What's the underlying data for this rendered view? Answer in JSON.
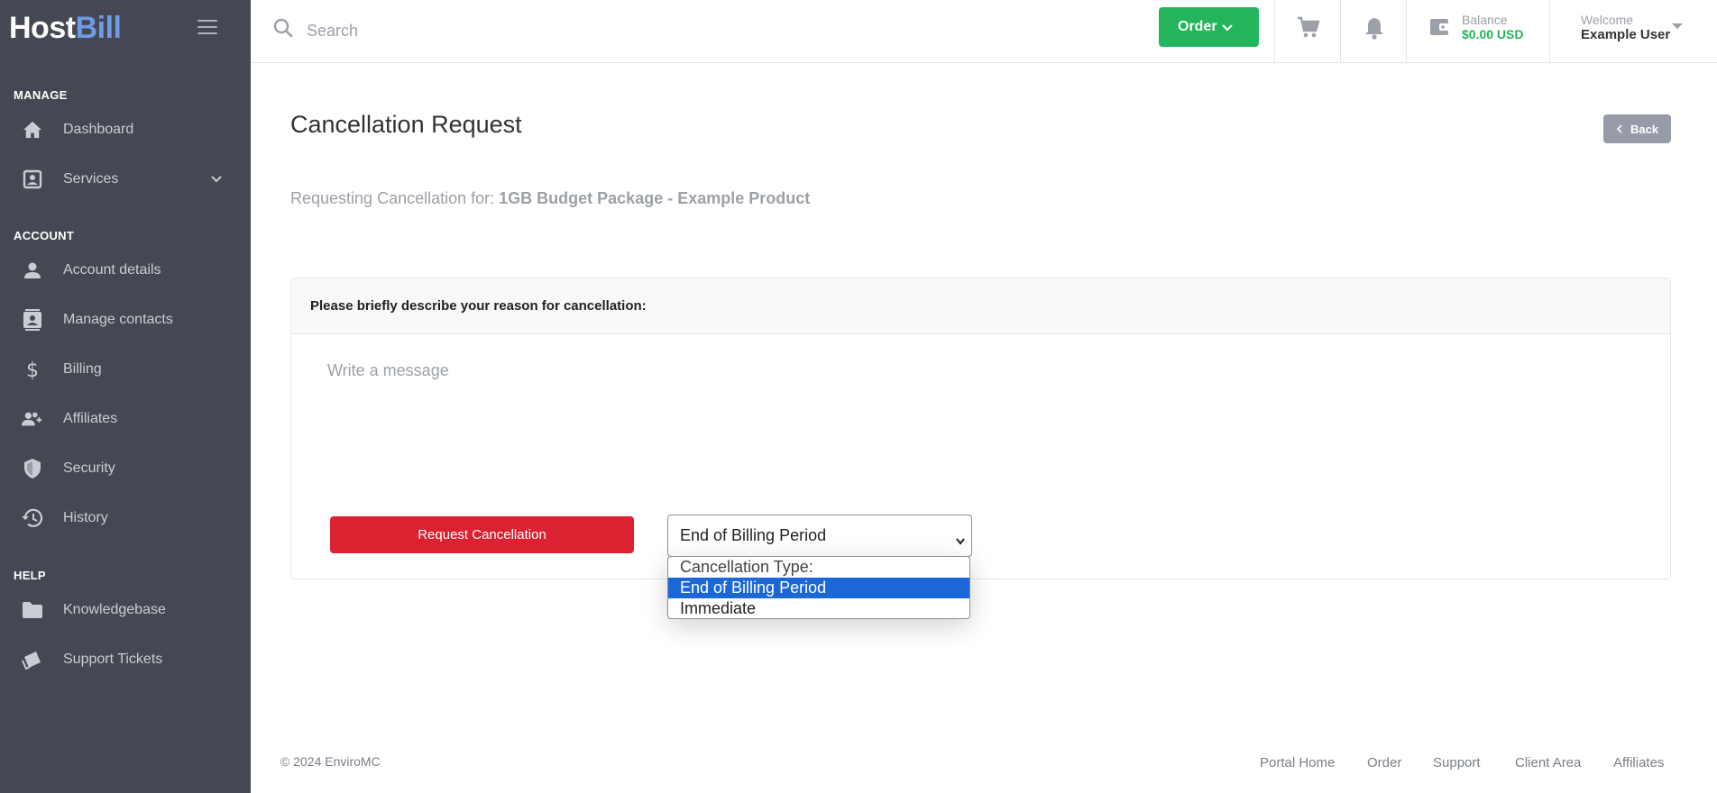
{
  "brand": {
    "host": "Host",
    "bill": "Bill"
  },
  "sidebar": {
    "sections": {
      "manage": "MANAGE",
      "account": "ACCOUNT",
      "help": "HELP"
    },
    "items": [
      {
        "label": "Dashboard",
        "icon": "home-icon"
      },
      {
        "label": "Services",
        "icon": "services-icon"
      },
      {
        "label": "Account details",
        "icon": "user-icon"
      },
      {
        "label": "Manage contacts",
        "icon": "contacts-icon"
      },
      {
        "label": "Billing",
        "icon": "dollar-icon"
      },
      {
        "label": "Affiliates",
        "icon": "affiliates-icon"
      },
      {
        "label": "Security",
        "icon": "shield-icon"
      },
      {
        "label": "History",
        "icon": "history-icon"
      },
      {
        "label": "Knowledgebase",
        "icon": "folder-icon"
      },
      {
        "label": "Support Tickets",
        "icon": "tickets-icon"
      }
    ]
  },
  "topbar": {
    "search_placeholder": "Search",
    "order_label": "Order",
    "balance_label": "Balance",
    "balance_value": "$0.00 USD",
    "welcome_label": "Welcome",
    "user_name": "Example User"
  },
  "main": {
    "title": "Cancellation Request",
    "back_label": "Back",
    "requesting_prefix": "Requesting Cancellation for:",
    "product_name": "1GB Budget Package - Example Product",
    "card_header": "Please briefly describe your reason for cancellation:",
    "message_placeholder": "Write a message",
    "request_button": "Request Cancellation",
    "select_value": "End of Billing Period",
    "dropdown": {
      "group_label": "Cancellation Type:",
      "options": [
        "End of Billing Period",
        "Immediate"
      ],
      "selected": "End of Billing Period"
    }
  },
  "footer": {
    "copyright": "© 2024 EnviroMC",
    "links": [
      "Portal Home",
      "Order",
      "Support",
      "Client Area",
      "Affiliates"
    ]
  },
  "colors": {
    "sidebar_bg": "#454852",
    "accent_blue": "#6d9be6",
    "order_green": "#22b55b",
    "danger_red": "#dc2130",
    "selected_option": "#1b67d8"
  }
}
